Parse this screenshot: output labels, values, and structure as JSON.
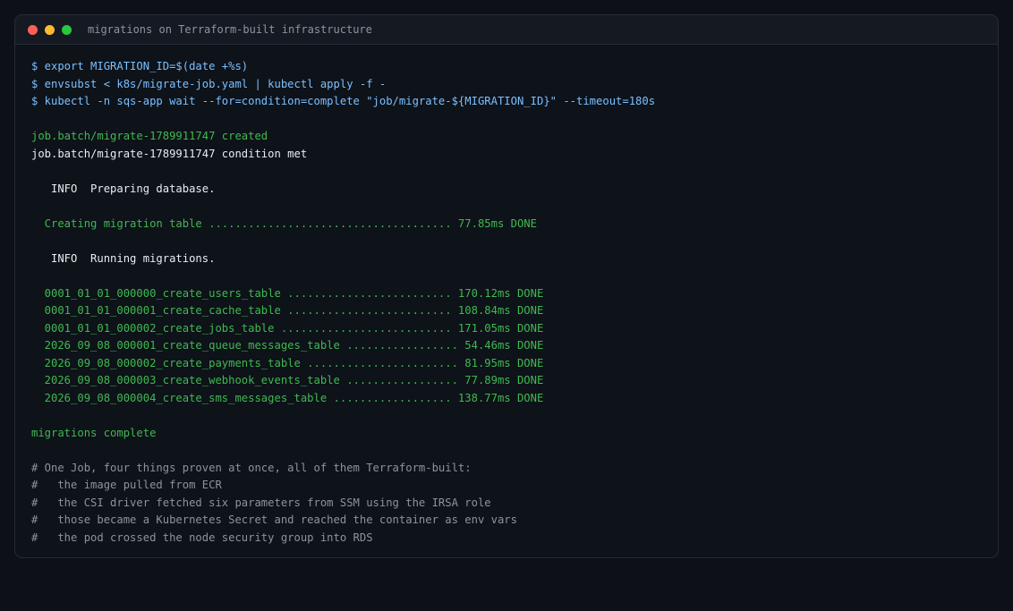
{
  "window": {
    "title": "migrations on Terraform-built infrastructure",
    "controls": {
      "close_color": "#ff5f57",
      "minimize_color": "#febc2e",
      "maximize_color": "#28c840"
    }
  },
  "colors": {
    "command": "#79c0ff",
    "success": "#3fb950",
    "output": "#e6edf3",
    "comment": "#8b949e"
  },
  "terminal": {
    "lines": [
      {
        "style": "cmd",
        "text": "$ export MIGRATION_ID=$(date +%s)"
      },
      {
        "style": "cmd",
        "text": "$ envsubst < k8s/migrate-job.yaml | kubectl apply -f -"
      },
      {
        "style": "cmd",
        "text": "$ kubectl -n sqs-app wait --for=condition=complete \"job/migrate-${MIGRATION_ID}\" --timeout=180s"
      },
      {
        "style": "blank",
        "text": ""
      },
      {
        "style": "green",
        "text": "job.batch/migrate-1789911747 created"
      },
      {
        "style": "white",
        "text": "job.batch/migrate-1789911747 condition met"
      },
      {
        "style": "blank",
        "text": ""
      },
      {
        "style": "white",
        "text": "   INFO  Preparing database."
      },
      {
        "style": "blank",
        "text": ""
      },
      {
        "style": "green",
        "text": "  Creating migration table ..................................... 77.85ms DONE"
      },
      {
        "style": "blank",
        "text": ""
      },
      {
        "style": "white",
        "text": "   INFO  Running migrations."
      },
      {
        "style": "blank",
        "text": ""
      },
      {
        "style": "green",
        "text": "  0001_01_01_000000_create_users_table ......................... 170.12ms DONE"
      },
      {
        "style": "green",
        "text": "  0001_01_01_000001_create_cache_table ......................... 108.84ms DONE"
      },
      {
        "style": "green",
        "text": "  0001_01_01_000002_create_jobs_table .......................... 171.05ms DONE"
      },
      {
        "style": "green",
        "text": "  2026_09_08_000001_create_queue_messages_table ................. 54.46ms DONE"
      },
      {
        "style": "green",
        "text": "  2026_09_08_000002_create_payments_table ....................... 81.95ms DONE"
      },
      {
        "style": "green",
        "text": "  2026_09_08_000003_create_webhook_events_table ................. 77.89ms DONE"
      },
      {
        "style": "green",
        "text": "  2026_09_08_000004_create_sms_messages_table .................. 138.77ms DONE"
      },
      {
        "style": "blank",
        "text": ""
      },
      {
        "style": "green",
        "text": "migrations complete"
      },
      {
        "style": "blank",
        "text": ""
      },
      {
        "style": "comment",
        "text": "# One Job, four things proven at once, all of them Terraform-built:"
      },
      {
        "style": "comment",
        "text": "#   the image pulled from ECR"
      },
      {
        "style": "comment",
        "text": "#   the CSI driver fetched six parameters from SSM using the IRSA role"
      },
      {
        "style": "comment",
        "text": "#   those became a Kubernetes Secret and reached the container as env vars"
      },
      {
        "style": "comment",
        "text": "#   the pod crossed the node security group into RDS"
      }
    ]
  }
}
